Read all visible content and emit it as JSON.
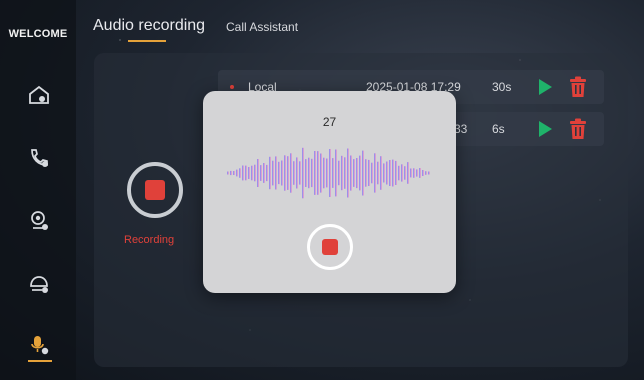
{
  "sidebar": {
    "welcome": "WELCOME",
    "items": [
      {
        "icon": "home-icon"
      },
      {
        "icon": "phone-icon"
      },
      {
        "icon": "camera-user-icon"
      },
      {
        "icon": "monitor-icon"
      },
      {
        "icon": "microphone-icon",
        "active": true
      }
    ]
  },
  "tabs": {
    "audio_recording": "Audio recording",
    "call_assistant": "Call Assistant"
  },
  "recorder": {
    "status_label": "Recording"
  },
  "recordings": [
    {
      "name": "Local",
      "datetime": "2025-01-08 17:29",
      "duration": "30s"
    },
    {
      "name": "",
      "datetime": "33",
      "duration": "6s"
    }
  ],
  "modal": {
    "counter": "27"
  },
  "colors": {
    "accent": "#e5a23a",
    "record_red": "#e0413a",
    "play_green": "#1fb36a",
    "delete_red": "#e0413a"
  }
}
